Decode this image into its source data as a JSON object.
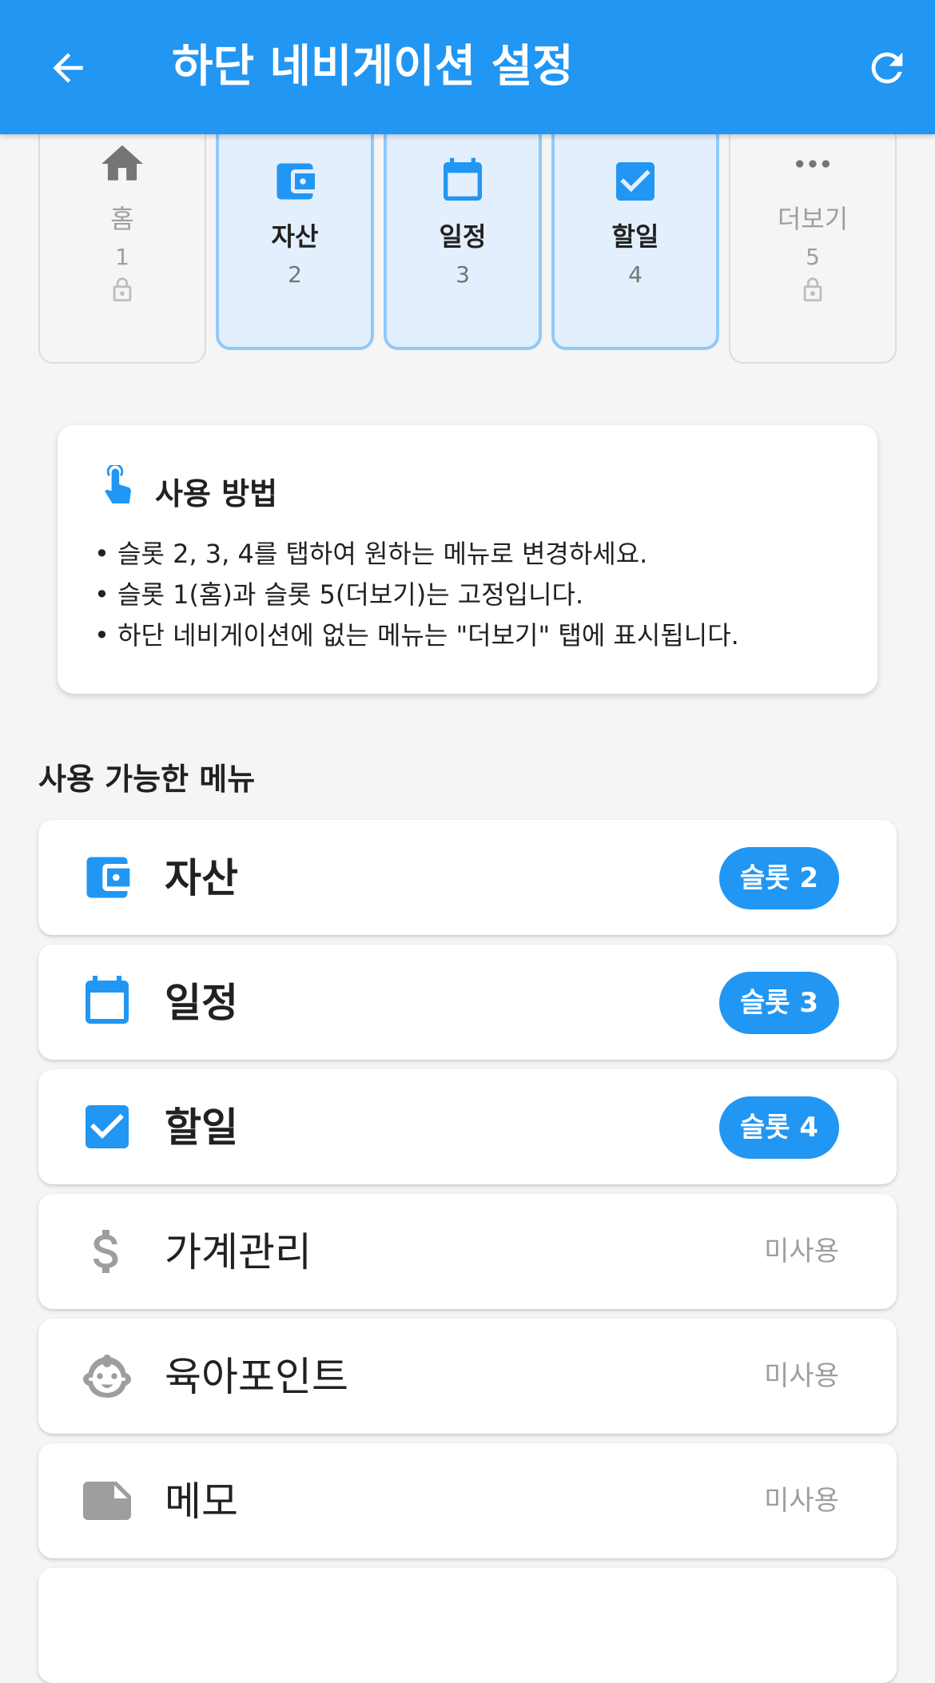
{
  "appbar": {
    "title": "하단 네비게이션 설정",
    "back_icon": "arrow-back-icon",
    "refresh_icon": "refresh-icon"
  },
  "slots": [
    {
      "label": "홈",
      "number": "1",
      "icon": "home-icon",
      "fixed": true
    },
    {
      "label": "자산",
      "number": "2",
      "icon": "wallet-icon",
      "fixed": false
    },
    {
      "label": "일정",
      "number": "3",
      "icon": "calendar-icon",
      "fixed": false
    },
    {
      "label": "할일",
      "number": "4",
      "icon": "checkbox-icon",
      "fixed": false
    },
    {
      "label": "더보기",
      "number": "5",
      "icon": "more-icon",
      "fixed": true
    }
  ],
  "info": {
    "title": "사용 방법",
    "icon": "touch-icon",
    "lines": [
      "• 슬롯 2, 3, 4를 탭하여 원하는 메뉴로 변경하세요.",
      "• 슬롯 1(홈)과 슬롯 5(더보기)는 고정입니다.",
      "• 하단 네비게이션에 없는 메뉴는 \"더보기\" 탭에 표시됩니다."
    ]
  },
  "section_title": "사용 가능한 메뉴",
  "menu_items": [
    {
      "label": "자산",
      "status": "슬롯 2",
      "used": true,
      "icon": "wallet-icon"
    },
    {
      "label": "일정",
      "status": "슬롯 3",
      "used": true,
      "icon": "calendar-icon"
    },
    {
      "label": "할일",
      "status": "슬롯 4",
      "used": true,
      "icon": "checkbox-icon"
    },
    {
      "label": "가계관리",
      "status": "미사용",
      "used": false,
      "icon": "dollar-icon"
    },
    {
      "label": "육아포인트",
      "status": "미사용",
      "used": false,
      "icon": "baby-face-icon"
    },
    {
      "label": "메모",
      "status": "미사용",
      "used": false,
      "icon": "note-icon"
    }
  ],
  "colors": {
    "primary": "#2196f3",
    "active_slot_bg": "#e3effc",
    "active_slot_border": "#90caf9",
    "muted": "#9e9e9e"
  }
}
